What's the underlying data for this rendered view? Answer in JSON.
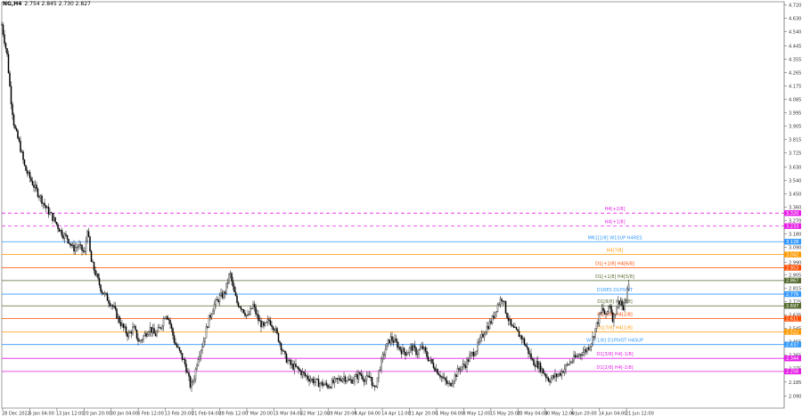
{
  "window": {
    "symbol_label": "NG,H4",
    "ohlc_text": "2.754 2.845 2.730 2.827"
  },
  "chart_data": {
    "type": "candlestick",
    "symbol": "NG",
    "timeframe": "H4",
    "ylim": [
      2.01,
      4.74
    ],
    "y_ticks": [
      "4.720",
      "4.630",
      "4.540",
      "4.445",
      "4.355",
      "4.265",
      "4.175",
      "4.085",
      "3.995",
      "3.905",
      "3.815",
      "3.725",
      "3.630",
      "3.540",
      "3.450",
      "3.360",
      "3.270",
      "3.180",
      "3.090",
      "2.990",
      "2.905",
      "2.815",
      "2.725",
      "2.635",
      "2.545",
      "2.455",
      "2.365",
      "2.275",
      "2.185",
      "2.090"
    ],
    "x_ticks": [
      "28 Dec 2022",
      "6 Jan 04:00",
      "13 Jan 12:00",
      "20 Jan 20:00",
      "30 Jan 04:00",
      "6 Feb 12:00",
      "13 Feb 20:00",
      "21 Feb 04:00",
      "28 Feb 12:00",
      "7 Mar 20:00",
      "15 Mar 04:00",
      "22 Mar 12:00",
      "29 Mar 20:00",
      "6 Apr 04:00",
      "14 Apr 12:00",
      "21 Apr 20:00",
      "1 May 04:00",
      "8 May 12:00",
      "15 May 20:00",
      "23 May 04:00",
      "30 May 12:00",
      "6 Jun 20:00",
      "14 Jun 04:00",
      "21 Jun 12:00"
    ],
    "price_path": [
      [
        0,
        4.66
      ],
      [
        3,
        4.55
      ],
      [
        8,
        4.38
      ],
      [
        12,
        4.1
      ],
      [
        16,
        3.9
      ],
      [
        22,
        3.78
      ],
      [
        28,
        3.62
      ],
      [
        34,
        3.55
      ],
      [
        40,
        3.48
      ],
      [
        46,
        3.42
      ],
      [
        52,
        3.35
      ],
      [
        58,
        3.3
      ],
      [
        64,
        3.24
      ],
      [
        70,
        3.18
      ],
      [
        76,
        3.15
      ],
      [
        82,
        3.08
      ],
      [
        88,
        3.1
      ],
      [
        95,
        3.05
      ],
      [
        98,
        3.22
      ],
      [
        102,
        3.0
      ],
      [
        108,
        2.9
      ],
      [
        114,
        2.8
      ],
      [
        120,
        2.75
      ],
      [
        126,
        2.7
      ],
      [
        132,
        2.62
      ],
      [
        138,
        2.55
      ],
      [
        144,
        2.5
      ],
      [
        150,
        2.55
      ],
      [
        156,
        2.45
      ],
      [
        162,
        2.5
      ],
      [
        168,
        2.55
      ],
      [
        174,
        2.5
      ],
      [
        180,
        2.55
      ],
      [
        186,
        2.65
      ],
      [
        190,
        2.6
      ],
      [
        196,
        2.45
      ],
      [
        202,
        2.38
      ],
      [
        208,
        2.3
      ],
      [
        214,
        2.15
      ],
      [
        218,
        2.22
      ],
      [
        222,
        2.35
      ],
      [
        228,
        2.45
      ],
      [
        234,
        2.6
      ],
      [
        240,
        2.7
      ],
      [
        246,
        2.75
      ],
      [
        252,
        2.78
      ],
      [
        258,
        2.92
      ],
      [
        262,
        2.8
      ],
      [
        266,
        2.72
      ],
      [
        272,
        2.68
      ],
      [
        278,
        2.62
      ],
      [
        284,
        2.7
      ],
      [
        290,
        2.6
      ],
      [
        296,
        2.55
      ],
      [
        302,
        2.6
      ],
      [
        308,
        2.55
      ],
      [
        314,
        2.45
      ],
      [
        320,
        2.35
      ],
      [
        326,
        2.3
      ],
      [
        332,
        2.28
      ],
      [
        338,
        2.25
      ],
      [
        344,
        2.22
      ],
      [
        350,
        2.2
      ],
      [
        356,
        2.18
      ],
      [
        362,
        2.17
      ],
      [
        368,
        2.16
      ],
      [
        374,
        2.18
      ],
      [
        380,
        2.2
      ],
      [
        386,
        2.22
      ],
      [
        392,
        2.19
      ],
      [
        398,
        2.21
      ],
      [
        404,
        2.24
      ],
      [
        410,
        2.2
      ],
      [
        416,
        2.22
      ],
      [
        420,
        2.12
      ],
      [
        426,
        2.28
      ],
      [
        432,
        2.4
      ],
      [
        438,
        2.48
      ],
      [
        444,
        2.45
      ],
      [
        450,
        2.4
      ],
      [
        456,
        2.38
      ],
      [
        462,
        2.42
      ],
      [
        468,
        2.38
      ],
      [
        474,
        2.42
      ],
      [
        480,
        2.35
      ],
      [
        486,
        2.3
      ],
      [
        492,
        2.25
      ],
      [
        498,
        2.2
      ],
      [
        504,
        2.16
      ],
      [
        510,
        2.22
      ],
      [
        516,
        2.28
      ],
      [
        522,
        2.3
      ],
      [
        528,
        2.36
      ],
      [
        534,
        2.4
      ],
      [
        540,
        2.48
      ],
      [
        546,
        2.55
      ],
      [
        552,
        2.6
      ],
      [
        558,
        2.7
      ],
      [
        564,
        2.76
      ],
      [
        568,
        2.65
      ],
      [
        574,
        2.55
      ],
      [
        580,
        2.52
      ],
      [
        586,
        2.48
      ],
      [
        592,
        2.4
      ],
      [
        598,
        2.32
      ],
      [
        604,
        2.3
      ],
      [
        610,
        2.25
      ],
      [
        616,
        2.2
      ],
      [
        622,
        2.22
      ],
      [
        628,
        2.24
      ],
      [
        634,
        2.28
      ],
      [
        640,
        2.32
      ],
      [
        646,
        2.35
      ],
      [
        652,
        2.38
      ],
      [
        658,
        2.4
      ],
      [
        664,
        2.46
      ],
      [
        670,
        2.58
      ],
      [
        676,
        2.68
      ],
      [
        680,
        2.62
      ],
      [
        684,
        2.72
      ],
      [
        688,
        2.6
      ],
      [
        692,
        2.7
      ],
      [
        696,
        2.74
      ],
      [
        700,
        2.66
      ],
      [
        704,
        2.8
      ],
      [
        706,
        2.83
      ]
    ],
    "levels": [
      {
        "label": "H4[+2/8]",
        "price": 3.32,
        "color": "#e61ee6",
        "dash": true,
        "tag": "3.320"
      },
      {
        "label": "H4[+1/8]",
        "price": 3.233,
        "color": "#e61ee6",
        "dash": true,
        "tag": "3.233"
      },
      {
        "label": "MN1[2/8] W1SUP H4RES",
        "price": 3.128,
        "color": "#3399ff",
        "dash": false,
        "tag": "3.128"
      },
      {
        "label": "H4[7/8]",
        "price": 3.042,
        "color": "#ff9900",
        "dash": false,
        "tag": "3.042"
      },
      {
        "label": "D1[+2/8] H4[6/8]",
        "price": 2.953,
        "color": "#ff4d00",
        "dash": false,
        "tag": "2.953"
      },
      {
        "label": "D1[+1/8] H4[5/8]",
        "price": 2.867,
        "color": "#556b2f",
        "dash": false,
        "tag": "2.867"
      },
      {
        "label": "D1RES D1PIVOT",
        "price": 2.776,
        "color": "#3399ff",
        "dash": false,
        "tag": "2.776"
      },
      {
        "label": "D1[8/8] H4[3/8]",
        "price": 2.697,
        "color": "#556b2f",
        "dash": false,
        "tag": "2.697"
      },
      {
        "label": "D1[6/8] H4[2/8]",
        "price": 2.611,
        "color": "#ff4d00",
        "dash": false,
        "tag": "2.611"
      },
      {
        "label": "D1[7/8] H4[1/8]",
        "price": 2.522,
        "color": "#ff9900",
        "dash": false,
        "tag": "2.522"
      },
      {
        "label": "W1[-1/8] D1PIVOT H4SUP",
        "price": 2.437,
        "color": "#3399ff",
        "dash": false,
        "tag": "2.437"
      },
      {
        "label": "D1[3/8] H4[-1/8]",
        "price": 2.344,
        "color": "#e61ee6",
        "dash": false,
        "tag": "2.344"
      },
      {
        "label": "D1[2/8] H4[-2/8]",
        "price": 2.256,
        "color": "#e61ee6",
        "dash": false,
        "tag": "2.256"
      }
    ]
  }
}
